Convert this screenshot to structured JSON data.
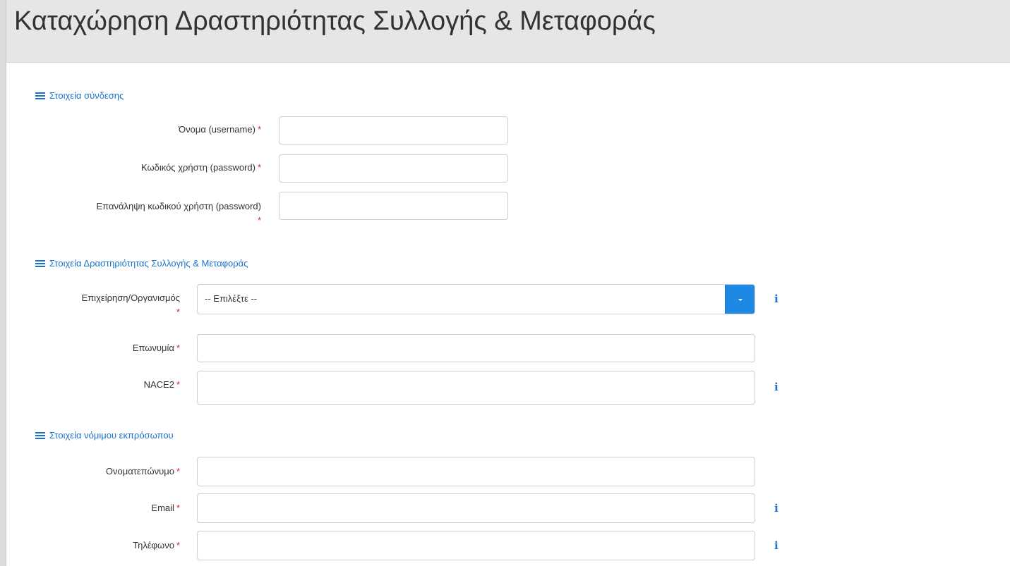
{
  "page": {
    "title": "Καταχώρηση Δραστηριότητας Συλλογής & Μεταφοράς"
  },
  "sections": {
    "login": {
      "title": "Στοιχεία σύνδεσης",
      "username_label": "Όνομα (username)",
      "password_label": "Κωδικός χρήστη (password)",
      "password_repeat_label": "Επανάληψη κωδικού χρήστη (password)"
    },
    "activity": {
      "title": "Στοιχεία Δραστηριότητας Συλλογής & Μεταφοράς",
      "organization_label": "Επιχείρηση/Οργανισμός",
      "organization_selected": "-- Επιλέξτε --",
      "name_label": "Επωνυμία",
      "nace_label": "NACE2"
    },
    "representative": {
      "title": "Στοιχεία νόμιμου εκπρόσωπου",
      "fullname_label": "Ονοματεπώνυμο",
      "email_label": "Email",
      "phone_label": "Τηλέφωνο"
    }
  },
  "required_marker": "*",
  "info_glyph": "i",
  "icons": {
    "section": "menu-icon",
    "info": "info-icon",
    "dropdown": "caret-down-icon"
  },
  "colors": {
    "accent": "#1a73c8",
    "required": "#e02020",
    "dropdown_button": "#1e88e5",
    "header_bg": "#e6e6e6"
  }
}
